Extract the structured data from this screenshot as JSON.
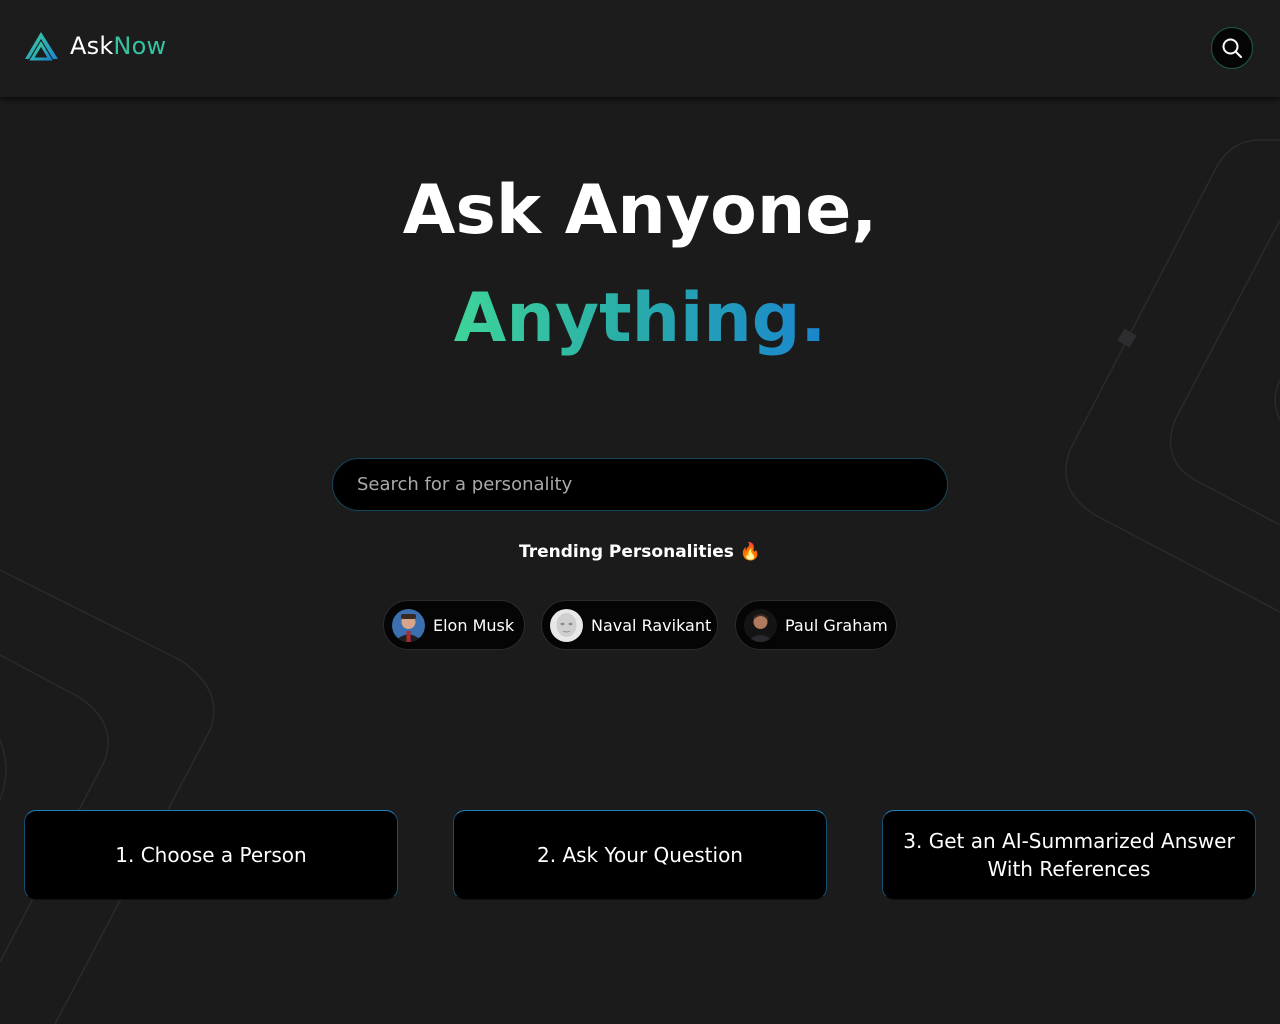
{
  "header": {
    "logo_part1": "Ask",
    "logo_part2": "Now",
    "logo_icon": "asknow-triangle-logo",
    "search_icon": "search-icon"
  },
  "hero": {
    "line1": "Ask Anyone,",
    "line2": "Anything."
  },
  "search": {
    "placeholder": "Search for a personality",
    "value": ""
  },
  "trending": {
    "title": "Trending Personalities 🔥",
    "personalities": [
      {
        "name": "Elon Musk"
      },
      {
        "name": "Naval Ravikant"
      },
      {
        "name": "Paul Graham"
      }
    ]
  },
  "steps": [
    {
      "label": "1. Choose a Person"
    },
    {
      "label": "2. Ask Your Question"
    },
    {
      "label": "3. Get an AI-Summarized Answer With References"
    }
  ],
  "colors": {
    "background": "#1b1b1c",
    "accent_green": "#34c3a1",
    "accent_blue": "#1a86cf",
    "card_bg": "#000000"
  }
}
